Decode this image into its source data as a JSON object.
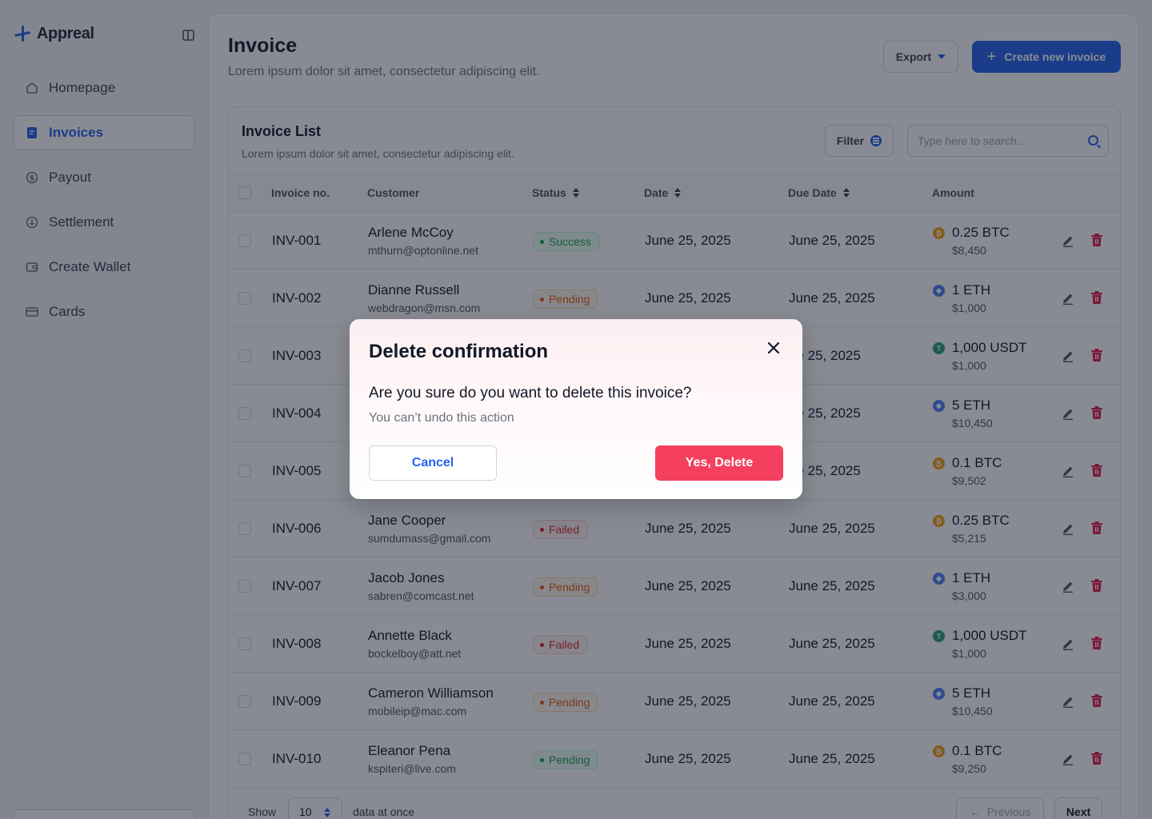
{
  "app": {
    "name": "Appreal"
  },
  "colors": {
    "accent": "#2563eb",
    "danger": "#f43f5e",
    "btc": "#f59e0b",
    "eth": "#4f7cf7",
    "usdt": "#26a17b"
  },
  "sidebar": {
    "items": [
      {
        "label": "Homepage",
        "icon": "home-icon",
        "active": false
      },
      {
        "label": "Invoices",
        "icon": "invoice-icon",
        "active": true
      },
      {
        "label": "Payout",
        "icon": "payout-icon",
        "active": false
      },
      {
        "label": "Settlement",
        "icon": "settlement-icon",
        "active": false
      },
      {
        "label": "Create Wallet",
        "icon": "wallet-icon",
        "active": false
      },
      {
        "label": "Cards",
        "icon": "card-icon",
        "active": false
      }
    ]
  },
  "header": {
    "title": "Invoice",
    "subtitle": "Lorem ipsum dolor sit amet, consectetur adipiscing elit.",
    "export_label": "Export",
    "create_label": "Create new invoice"
  },
  "list": {
    "title": "Invoice List",
    "subtitle": "Lorem ipsum dolor sit amet, consectetur adipiscing elit.",
    "filter_label": "Filter",
    "search_placeholder": "Type here to search..."
  },
  "table": {
    "columns": [
      "Invoice no.",
      "Customer",
      "Status",
      "Date",
      "Due Date",
      "Amount"
    ],
    "rows": [
      {
        "id": "INV-001",
        "name": "Arlene McCoy",
        "email": "mthurn@optonline.net",
        "status": "Success",
        "status_type": "success",
        "date": "June 25, 2025",
        "due": "June 25, 2025",
        "coin": "btc",
        "amount": "0.25 BTC",
        "usd": "$8,450"
      },
      {
        "id": "INV-002",
        "name": "Dianne Russell",
        "email": "webdragon@msn.com",
        "status": "Pending",
        "status_type": "pending",
        "date": "June 25, 2025",
        "due": "June 25, 2025",
        "coin": "eth",
        "amount": "1 ETH",
        "usd": "$1,000"
      },
      {
        "id": "INV-003",
        "name": "",
        "email": "",
        "status": "",
        "status_type": "",
        "date": "",
        "due": "ne 25, 2025",
        "coin": "usdt",
        "amount": "1,000 USDT",
        "usd": "$1,000"
      },
      {
        "id": "INV-004",
        "name": "",
        "email": "",
        "status": "",
        "status_type": "",
        "date": "",
        "due": "ne 25, 2025",
        "coin": "eth",
        "amount": "5 ETH",
        "usd": "$10,450"
      },
      {
        "id": "INV-005",
        "name": "",
        "email": "",
        "status": "",
        "status_type": "",
        "date": "",
        "due": "ne 25, 2025",
        "coin": "btc",
        "amount": "0.1 BTC",
        "usd": "$9,502"
      },
      {
        "id": "INV-006",
        "name": "Jane Cooper",
        "email": "sumdumass@gmail.com",
        "status": "Failed",
        "status_type": "failed",
        "date": "June 25, 2025",
        "due": "June 25, 2025",
        "coin": "btc",
        "amount": "0.25 BTC",
        "usd": "$5,215"
      },
      {
        "id": "INV-007",
        "name": "Jacob Jones",
        "email": "sabren@comcast.net",
        "status": "Pending",
        "status_type": "pending",
        "date": "June 25, 2025",
        "due": "June 25, 2025",
        "coin": "eth",
        "amount": "1 ETH",
        "usd": "$3,000"
      },
      {
        "id": "INV-008",
        "name": "Annette Black",
        "email": "bockelboy@att.net",
        "status": "Failed",
        "status_type": "failed",
        "date": "June 25, 2025",
        "due": "June 25, 2025",
        "coin": "usdt",
        "amount": "1,000 USDT",
        "usd": "$1,000"
      },
      {
        "id": "INV-009",
        "name": "Cameron Williamson",
        "email": "mobileip@mac.com",
        "status": "Pending",
        "status_type": "pending",
        "date": "June 25, 2025",
        "due": "June 25, 2025",
        "coin": "eth",
        "amount": "5 ETH",
        "usd": "$10,450"
      },
      {
        "id": "INV-010",
        "name": "Eleanor Pena",
        "email": "kspiteri@live.com",
        "status": "Pending",
        "status_type": "success",
        "date": "June 25, 2025",
        "due": "June 25, 2025",
        "coin": "btc",
        "amount": "0.1 BTC",
        "usd": "$9,250"
      }
    ]
  },
  "pagination": {
    "show_label": "Show",
    "page_size": "10",
    "data_label": "data at once",
    "prev_label": "Previous",
    "next_label": "Next"
  },
  "modal": {
    "title": "Delete confirmation",
    "question": "Are you sure do you want to delete this invoice?",
    "note": "You can’t undo this action",
    "cancel_label": "Cancel",
    "confirm_label": "Yes, Delete"
  }
}
